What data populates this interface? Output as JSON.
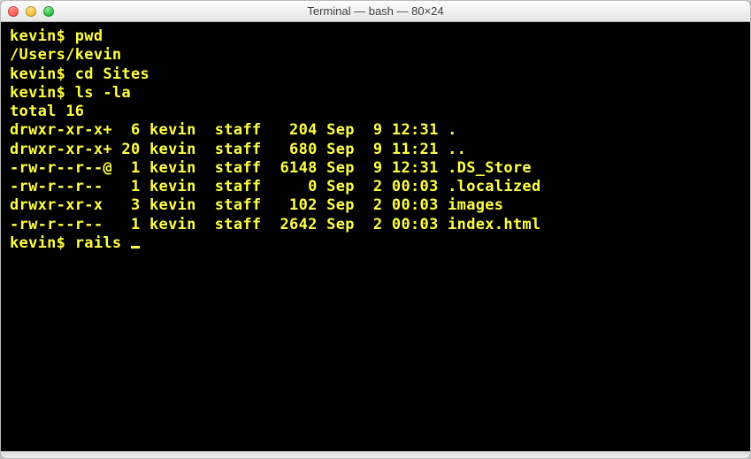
{
  "window": {
    "title": "Terminal — bash — 80×24"
  },
  "terminal": {
    "prompt": "kevin$ ",
    "lines": [
      {
        "prompt": true,
        "text": "pwd"
      },
      {
        "prompt": false,
        "text": "/Users/kevin"
      },
      {
        "prompt": true,
        "text": "cd Sites"
      },
      {
        "prompt": true,
        "text": "ls -la"
      },
      {
        "prompt": false,
        "text": "total 16"
      },
      {
        "prompt": false,
        "text": "drwxr-xr-x+  6 kevin  staff   204 Sep  9 12:31 ."
      },
      {
        "prompt": false,
        "text": "drwxr-xr-x+ 20 kevin  staff   680 Sep  9 11:21 .."
      },
      {
        "prompt": false,
        "text": "-rw-r--r--@  1 kevin  staff  6148 Sep  9 12:31 .DS_Store"
      },
      {
        "prompt": false,
        "text": "-rw-r--r--   1 kevin  staff     0 Sep  2 00:03 .localized"
      },
      {
        "prompt": false,
        "text": "drwxr-xr-x   3 kevin  staff   102 Sep  2 00:03 images"
      },
      {
        "prompt": false,
        "text": "-rw-r--r--   1 kevin  staff  2642 Sep  2 00:03 index.html"
      }
    ],
    "current_input": "rails "
  }
}
